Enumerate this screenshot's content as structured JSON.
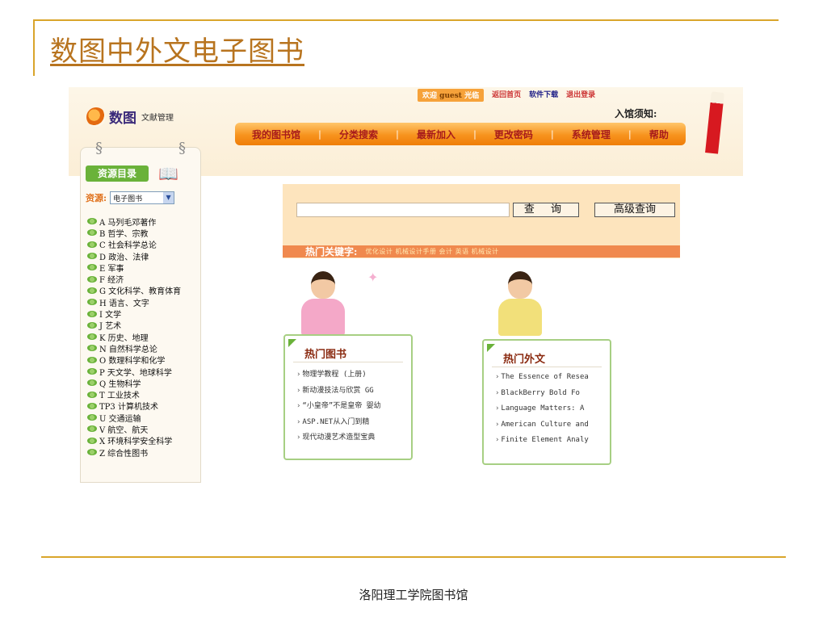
{
  "slide": {
    "title": "数图中外文电子图书",
    "footer": "洛阳理工学院图书馆"
  },
  "app": {
    "logo_text": "数图",
    "logo_sub": "文献管理",
    "topbar": {
      "welcome": "欢迎",
      "user": "guest",
      "welcome_suffix": "光临",
      "home": "返回首页",
      "download": "软件下载",
      "logout": "退出登录"
    },
    "notice": "入馆须知:",
    "nav": [
      "我的图书馆",
      "分类搜索",
      "最新加入",
      "更改密码",
      "系统管理",
      "帮助"
    ]
  },
  "sidebar": {
    "badge": "资源目录",
    "resource_label": "资源:",
    "resource_value": "电子图书",
    "categories": [
      "A 马列毛邓著作",
      "B 哲学、宗教",
      "C 社会科学总论",
      "D 政治、法律",
      "E 军事",
      "F 经济",
      "G 文化科学、教育体育",
      "H 语言、文字",
      "I 文学",
      "J 艺术",
      "K 历史、地理",
      "N 自然科学总论",
      "O 数理科学和化学",
      "P 天文学、地球科学",
      "Q 生物科学",
      "T 工业技术",
      "TP3 计算机技术",
      "U 交通运输",
      "V 航空、航天",
      "X 环境科学安全科学",
      "Z 综合性图书"
    ]
  },
  "search": {
    "input_value": "",
    "search_button": "查 询",
    "advanced_button": "高级查询",
    "hot_keywords_label": "热门关键字:",
    "hot_keywords": "优化设计 机械设计手册 会计 英语 机械设计"
  },
  "hot_books": {
    "title": "热门图书",
    "items": [
      "物理学教程 (上册)",
      "新动漫技法与欣赏 GG",
      "“小皇帝”不是皇帝 婴幼",
      "ASP.NET从入门到精",
      "现代动漫艺术造型宝典"
    ]
  },
  "hot_foreign": {
    "title": "热门外文",
    "items": [
      "The Essence of Resea",
      "BlackBerry Bold Fo",
      "Language Matters: A",
      "American Culture and",
      "Finite Element Analy"
    ]
  }
}
